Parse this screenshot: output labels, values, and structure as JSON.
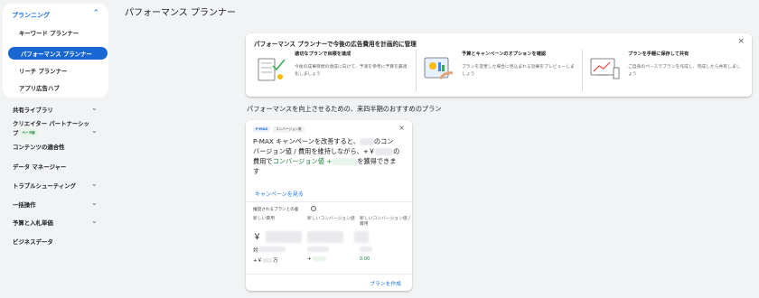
{
  "sidebar": {
    "group_title": "プランニング",
    "group_items": [
      "キーワード プランナー",
      "パフォーマンス プランナー",
      "リーチ プランナー",
      "アプリ広告ハブ"
    ],
    "nav_items": [
      "共有ライブラリ",
      "クリエイター パートナーシップ",
      "コンテンツの適合性",
      "データ マネージャー",
      "トラブルシューティング",
      "一括操作",
      "予算と入札単価",
      "ビジネスデータ"
    ],
    "badge_new": "ベータ版"
  },
  "page": {
    "title": "パフォーマンス プランナー"
  },
  "intro": {
    "title": "パフォーマンス プランナーで今後の広告費用を計画的に管理",
    "features": [
      {
        "title": "適切なプランで目標を達成",
        "desc": "今後の成果目標の達成に向けて、予測を参考に予算を最適化しましょう"
      },
      {
        "title": "予算とキャンペーンのオプションを確認",
        "desc": "プランを変更した場合に見込まれる効果をプレビューしましょう"
      },
      {
        "title": "プランを手軽に保存して共有",
        "desc": "ご自身のペースでプランを作成し、完成したら共有しましょう"
      }
    ]
  },
  "section_heading": "パフォーマンスを向上させるための、来四半期のおすすめのプラン",
  "rec": {
    "chip_pmax": "P-MAX",
    "chip_conv": "コンバージョン数",
    "line1a": "P-MAX キャンペーンを改善すると、",
    "line1b": "のコン",
    "line2a": "バージョン値 / 費用を維持しながら、+￥",
    "line2b": "の",
    "line3a": "費用で",
    "line3b": "コンバージョン値 +",
    "line3c": "を獲得できま",
    "line4": "す",
    "link": "キャンペーンを見る",
    "plan_label": "推奨されるプランとの差",
    "info": "i",
    "col1": "新しい費用",
    "col2": "新しいコンバージョン値",
    "col3": "新しいコンバージョン値 / 費用",
    "yen": "￥",
    "pair": "対",
    "spend_prefix": "+￥",
    "spend_suffix": "万",
    "plus": "+",
    "roas": "0.00",
    "create": "プランを作成"
  }
}
